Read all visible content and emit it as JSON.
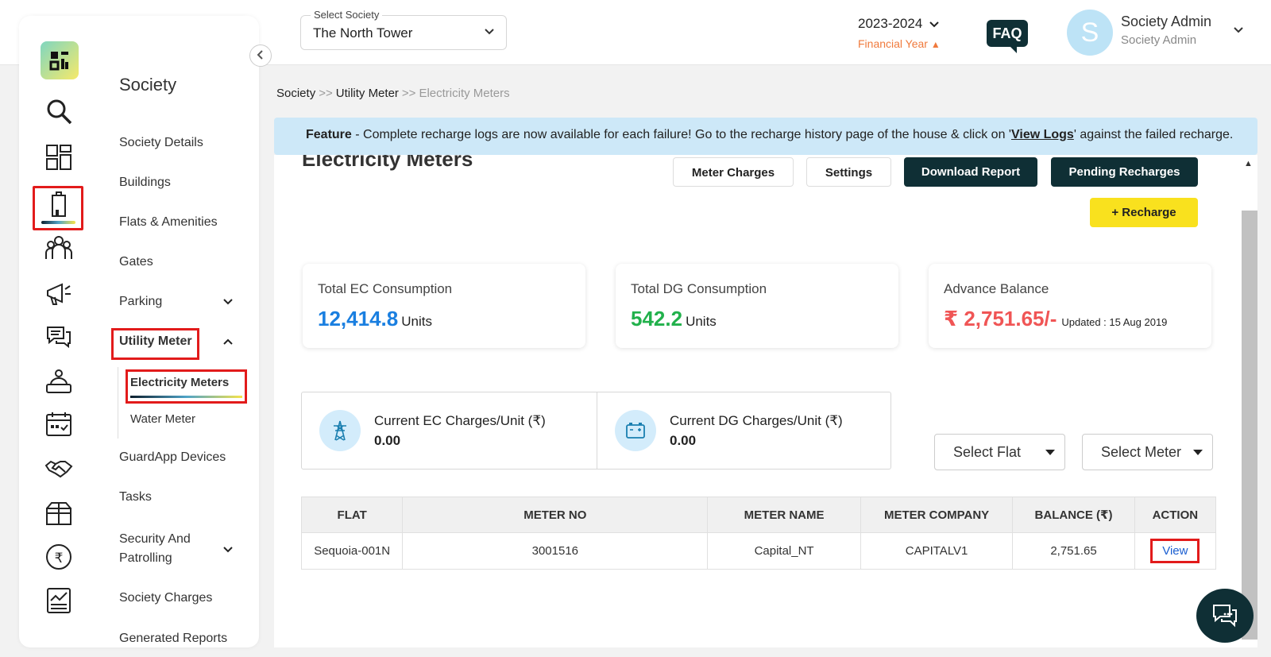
{
  "header": {
    "society_select_label": "Select Society",
    "society_select_value": "The North Tower",
    "financial_year_value": "2023-2024",
    "financial_year_label": "Financial Year",
    "faq_label": "FAQ",
    "avatar_letter": "S",
    "user_name": "Society Admin",
    "user_role": "Society Admin"
  },
  "sidebar": {
    "title": "Society",
    "items": [
      {
        "label": "Society Details"
      },
      {
        "label": "Buildings"
      },
      {
        "label": "Flats & Amenities"
      },
      {
        "label": "Gates"
      },
      {
        "label": "Parking"
      },
      {
        "label": "Utility Meter"
      },
      {
        "label": "GuardApp Devices"
      },
      {
        "label": "Tasks"
      },
      {
        "label": "Security And Patrolling"
      },
      {
        "label": "Society Charges"
      },
      {
        "label": "Generated Reports"
      }
    ],
    "sub_items": [
      {
        "label": "Electricity Meters"
      },
      {
        "label": "Water Meter"
      }
    ],
    "rail_icons": [
      "logo-icon",
      "search-icon",
      "dashboard-icon",
      "building-icon",
      "residents-icon",
      "announcement-icon",
      "chat-icon",
      "helpdesk-icon",
      "calendar-icon",
      "partners-icon",
      "package-icon",
      "rupee-icon",
      "reports-icon"
    ]
  },
  "breadcrumb": {
    "level1": "Society",
    "level2": "Utility Meter",
    "level3": "Electricity Meters",
    "separator": ">>"
  },
  "banner": {
    "bold": "Feature",
    "text_before": " - Complete recharge logs are now available for each failure! Go to the recharge history page of the house & click on '",
    "link": "View Logs",
    "text_after": "' against the failed recharge."
  },
  "page": {
    "title": "Electricity Meters",
    "buttons": {
      "meter_charges": "Meter Charges",
      "settings": "Settings",
      "download_report": "Download Report",
      "pending_recharges": "Pending Recharges",
      "recharge": "+ Recharge"
    }
  },
  "stats": {
    "ec": {
      "title": "Total EC Consumption",
      "value": "12,414.8",
      "unit": "Units"
    },
    "dg": {
      "title": "Total DG Consumption",
      "value": "542.2",
      "unit": "Units"
    },
    "advance": {
      "title": "Advance Balance",
      "value": "₹ 2,751.65/-",
      "updated": "Updated : 15 Aug 2019"
    }
  },
  "charges": {
    "ec": {
      "label": "Current EC Charges/Unit (₹)",
      "value": "0.00"
    },
    "dg": {
      "label": "Current DG Charges/Unit (₹)",
      "value": "0.00"
    }
  },
  "filters": {
    "flat": "Select Flat",
    "meter": "Select Meter"
  },
  "table": {
    "headers": [
      "FLAT",
      "METER NO",
      "METER NAME",
      "METER COMPANY",
      "BALANCE (₹)",
      "ACTION"
    ],
    "rows": [
      {
        "flat": "Sequoia-001N",
        "meter_no": "3001516",
        "meter_name": "Capital_NT",
        "company": "CAPITALV1",
        "balance": "2,751.65",
        "action": "View"
      }
    ]
  },
  "colors": {
    "accent_dark": "#0f2f35",
    "accent_yellow": "#f9e11e",
    "ec_blue": "#1a7fe0",
    "dg_green": "#22b14c",
    "balance_red": "#f05555",
    "highlight_red": "#e21b1b"
  }
}
